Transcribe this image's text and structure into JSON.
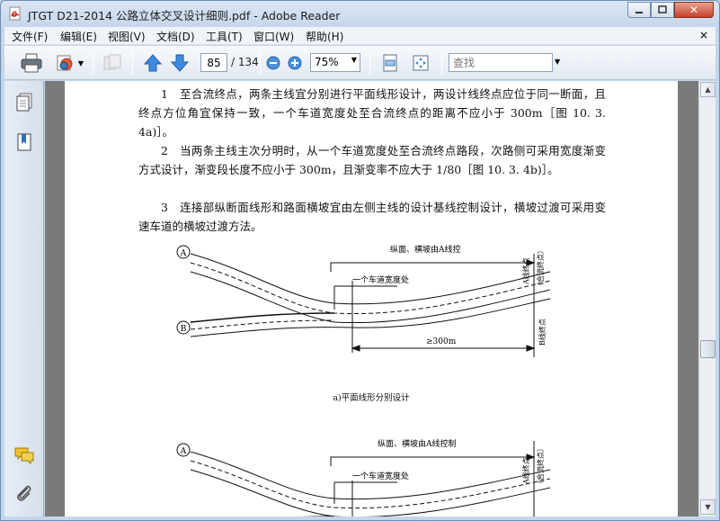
{
  "window": {
    "title": "JTGT D21-2014 公路立体交叉设计细则.pdf - Adobe Reader",
    "close_label": "✕"
  },
  "menu": {
    "items": [
      "文件(F)",
      "编辑(E)",
      "视图(V)",
      "文档(D)",
      "工具(T)",
      "窗口(W)",
      "帮助(H)"
    ],
    "close": "×"
  },
  "toolbar": {
    "page_current": "85",
    "page_total": "/ 134",
    "zoom": "75%",
    "search_placeholder": "查找"
  },
  "document": {
    "para1": "1　至合流终点，两条主线宜分别进行平面线形设计，两设计线终点应位于同一断面，且终点方位角宜保持一致，一个车道宽度处至合流终点的距离不应小于 300m［图 10. 3. 4a)］。",
    "para2": "2　当两条主线主次分明时，从一个车道宽度处至合流终点路段，次路侧可采用宽度渐变方式设计，渐变段长度不应小于 300m，且渐变率不应大于 1/80［图 10. 3. 4b)］。",
    "para3": "3　连接部纵断面线形和路面横坡宜由左侧主线的设计基线控制设计，横坡过渡可采用变速车道的横坡过渡方法。",
    "fig_a": {
      "label_A": "A",
      "label_B": "B",
      "top_note": "纵面、横坡由A线控",
      "lane_note": "一个车道宽度处",
      "end_A": "A线终点",
      "end_merge": "（合流终点）",
      "end_B": "B线终点",
      "dist": "≥300m",
      "caption": "a)平面线形分别设计"
    },
    "fig_b": {
      "label_A": "A",
      "top_note": "纵面、横坡由A线控制",
      "lane_note": "一个车道宽度处",
      "end_A": "A线终点",
      "end_merge": "（合流终点）"
    }
  }
}
